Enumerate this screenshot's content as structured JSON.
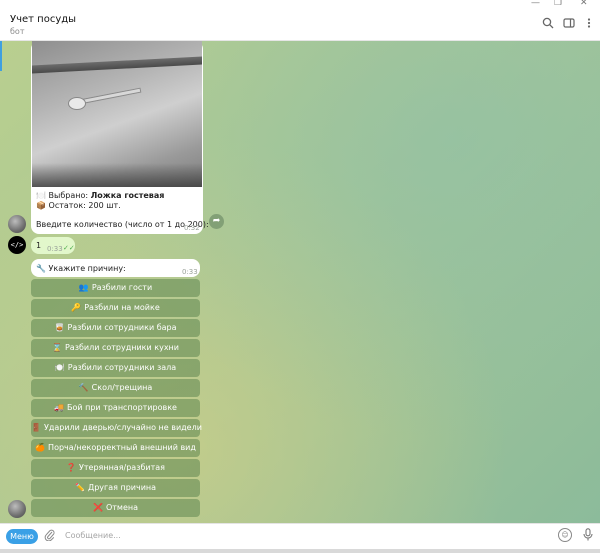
{
  "window": {
    "controls": [
      "—",
      "❐",
      "✕"
    ]
  },
  "header": {
    "title": "Учет посуды",
    "subtitle": "бот"
  },
  "message1": {
    "selected_prefix": "Выбрано: ",
    "selected_item": "Ложка гостевая",
    "stock_text": "Остаток: 200 шт.",
    "prompt": "Введите количество (число от 1 до 200):",
    "time": "0:32",
    "icon_tray": "🍽️",
    "icon_box": "📦"
  },
  "message2": {
    "text": "1",
    "time": "0:33",
    "check": "✓✓"
  },
  "codebot_avatar": "</>",
  "message3": {
    "prompt": "Укажите причину:",
    "time": "0:33",
    "icon": "🔧"
  },
  "buttons": [
    {
      "icon": "👥",
      "label": "Разбили гости"
    },
    {
      "icon": "🔑",
      "label": "Разбили на мойке"
    },
    {
      "icon": "🥃",
      "label": "Разбили сотрудники бара"
    },
    {
      "icon": "⌛",
      "label": "Разбили сотрудники кухни"
    },
    {
      "icon": "🍽️",
      "label": "Разбили сотрудники зала"
    },
    {
      "icon": "🔨",
      "label": "Скол/трещина"
    },
    {
      "icon": "🚚",
      "label": "Бой при транспортировке"
    },
    {
      "icon": "🚪",
      "label": "Ударили дверью/случайно не видели"
    },
    {
      "icon": "🍊",
      "label": "Порча/некорректный внешний вид"
    },
    {
      "icon": "❓",
      "label": "Утерянная/разбитая"
    },
    {
      "icon": "✏️",
      "label": "Другая причина"
    },
    {
      "icon": "❌",
      "label": "Отмена"
    }
  ],
  "composer": {
    "menu_label": "Меню",
    "placeholder": "Сообщение..."
  }
}
